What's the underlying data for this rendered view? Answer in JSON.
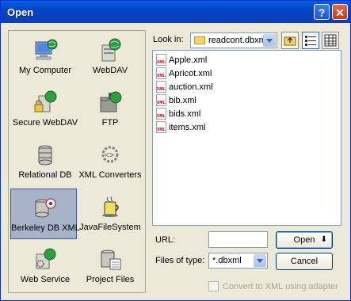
{
  "window": {
    "title": "Open",
    "help_glyph": "?",
    "close_glyph": "✕"
  },
  "places": [
    {
      "id": "my-computer",
      "label": "My Computer",
      "icon": "computer-globe-icon"
    },
    {
      "id": "webdav",
      "label": "WebDAV",
      "icon": "server-globe-icon"
    },
    {
      "id": "secure-webdav",
      "label": "Secure WebDAV",
      "icon": "server-lock-globe-icon"
    },
    {
      "id": "ftp",
      "label": "FTP",
      "icon": "folder-globe-icon"
    },
    {
      "id": "relational-db",
      "label": "Relational DB",
      "icon": "database-icon"
    },
    {
      "id": "xml-converters",
      "label": "XML Converters",
      "icon": "xml-gear-icon"
    },
    {
      "id": "berkeley-db-xml",
      "label": "Berkeley DB XML",
      "icon": "berkeley-db-icon",
      "selected": true
    },
    {
      "id": "java-file-system",
      "label": "JavaFileSystem",
      "icon": "java-cup-icon"
    },
    {
      "id": "web-service",
      "label": "Web Service",
      "icon": "web-service-icon"
    },
    {
      "id": "project-files",
      "label": "Project Files",
      "icon": "project-files-icon"
    }
  ],
  "lookin": {
    "label": "Look in:",
    "value": "readcont.dbxml"
  },
  "files": [
    "Apple.xml",
    "Apricot.xml",
    "auction.xml",
    "bib.xml",
    "bids.xml",
    "items.xml"
  ],
  "file_icon_text": "XML",
  "url": {
    "label": "URL:",
    "value": ""
  },
  "filetype": {
    "label": "Files of type:",
    "value": "*.dbxml"
  },
  "buttons": {
    "open": "Open",
    "open_glyph": "⬇",
    "cancel": "Cancel"
  },
  "convert": {
    "label": "Convert to XML using adapter",
    "checked": false,
    "enabled": false
  }
}
